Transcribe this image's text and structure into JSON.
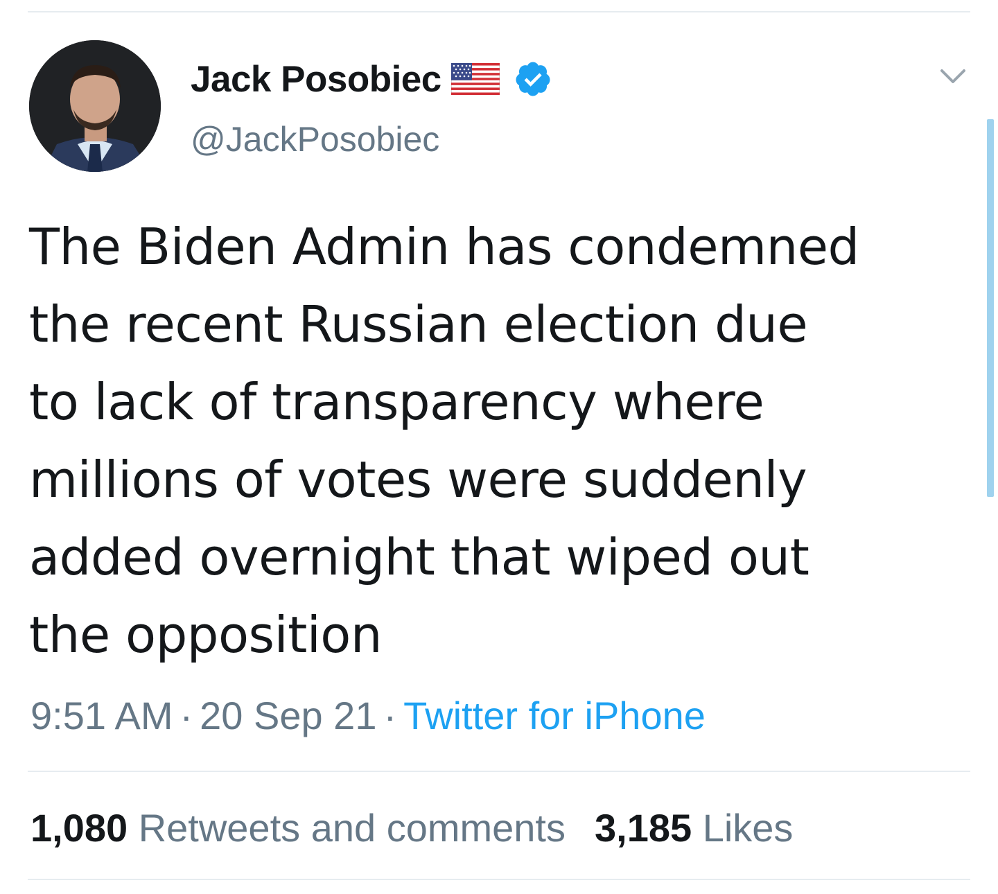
{
  "tweet": {
    "author": {
      "display_name": "Jack Posobiec",
      "handle": "@JackPosobiec",
      "flag_icon": "us-flag-icon",
      "verified_icon": "verified-badge-icon"
    },
    "menu_icon": "chevron-down-icon",
    "text": "The Biden Admin has condemned\nthe recent Russian election due\nto lack of transparency where\nmillions of votes were suddenly\nadded overnight that wiped out\nthe opposition",
    "time": "9:51 AM",
    "separator": "·",
    "date": "20 Sep 21",
    "source": "Twitter for iPhone",
    "stats": {
      "retweets_count": "1,080",
      "retweets_label": "Retweets and comments",
      "likes_count": "3,185",
      "likes_label": "Likes"
    }
  },
  "colors": {
    "text_primary": "#14171a",
    "text_secondary": "#657786",
    "accent": "#1da1f2",
    "divider": "#e6ecf0",
    "scrollbar": "#9fd2ee"
  }
}
